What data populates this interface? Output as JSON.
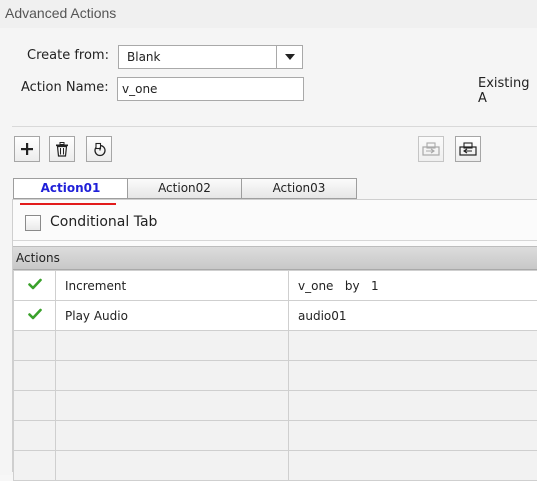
{
  "window": {
    "title": "Advanced Actions"
  },
  "form": {
    "create_from_label": "Create from:",
    "create_from_value": "Blank",
    "action_name_label": "Action Name:",
    "action_name_value": "v_one",
    "existing_label": "Existing A"
  },
  "toolbar": {
    "add_icon": "plus-icon",
    "delete_icon": "trash-icon",
    "duplicate_icon": "duplicate-icon",
    "import_icon": "import-icon",
    "export_icon": "export-icon"
  },
  "tabs": [
    {
      "label": "Action01",
      "active": true
    },
    {
      "label": "Action02",
      "active": false
    },
    {
      "label": "Action03",
      "active": false
    }
  ],
  "conditional": {
    "label": "Conditional Tab",
    "checked": false
  },
  "actions": {
    "header": "Actions",
    "rows": [
      {
        "checked": true,
        "action": "Increment",
        "detail": "v_one   by   1"
      },
      {
        "checked": true,
        "action": "Play Audio",
        "detail": "audio01"
      }
    ]
  },
  "colors": {
    "active_tab_text": "#1f1fd8",
    "active_tab_underline": "#e21b1b",
    "check_green": "#3aa12b"
  }
}
